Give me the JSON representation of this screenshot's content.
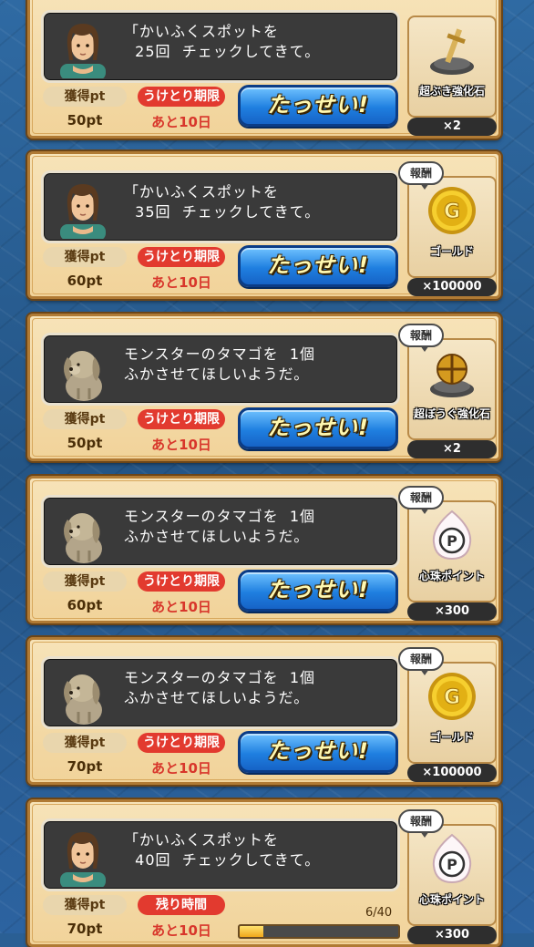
{
  "quests": [
    {
      "avatar": "woman-icon",
      "message_lines": [
        "「かいふくスポットを",
        "  25回  チェックしてきて。"
      ],
      "pt_label": "獲得pt",
      "pt_value": "50pt",
      "deadline_label": "うけとり期限",
      "remaining": "あと10日",
      "button_label": "たっせい!",
      "reward_label": "",
      "reward_icon": "sword-on-rock-icon",
      "reward_name": "超ぶき強化石",
      "reward_qty": "×2"
    },
    {
      "avatar": "woman-icon",
      "message_lines": [
        "「かいふくスポットを",
        "  35回  チェックしてきて。"
      ],
      "pt_label": "獲得pt",
      "pt_value": "60pt",
      "deadline_label": "うけとり期限",
      "remaining": "あと10日",
      "button_label": "たっせい!",
      "reward_label": "報酬",
      "reward_icon": "gold-coin-icon",
      "reward_name": "ゴールド",
      "reward_qty": "×100000"
    },
    {
      "avatar": "dog-icon",
      "message_lines": [
        "モンスターのタマゴを  1個",
        "ふかさせてほしいようだ。"
      ],
      "pt_label": "獲得pt",
      "pt_value": "50pt",
      "deadline_label": "うけとり期限",
      "remaining": "あと10日",
      "button_label": "たっせい!",
      "reward_label": "報酬",
      "reward_icon": "orb-on-rock-icon",
      "reward_name": "超ぼうぐ強化石",
      "reward_qty": "×2"
    },
    {
      "avatar": "dog-icon",
      "message_lines": [
        "モンスターのタマゴを  1個",
        "ふかさせてほしいようだ。"
      ],
      "pt_label": "獲得pt",
      "pt_value": "60pt",
      "deadline_label": "うけとり期限",
      "remaining": "あと10日",
      "button_label": "たっせい!",
      "reward_label": "報酬",
      "reward_icon": "heart-orb-point-icon",
      "reward_name": "心珠ポイント",
      "reward_qty": "×300"
    },
    {
      "avatar": "dog-icon",
      "message_lines": [
        "モンスターのタマゴを  1個",
        "ふかさせてほしいようだ。"
      ],
      "pt_label": "獲得pt",
      "pt_value": "70pt",
      "deadline_label": "うけとり期限",
      "remaining": "あと10日",
      "button_label": "たっせい!",
      "reward_label": "報酬",
      "reward_icon": "gold-coin-icon",
      "reward_name": "ゴールド",
      "reward_qty": "×100000"
    },
    {
      "avatar": "woman-icon",
      "message_lines": [
        "「かいふくスポットを",
        "  40回  チェックしてきて。"
      ],
      "pt_label": "獲得pt",
      "pt_value": "70pt",
      "deadline_label": "残り時間",
      "remaining": "あと10日",
      "progress_text": "6/40",
      "progress_fraction": 0.15,
      "reward_label": "報酬",
      "reward_icon": "heart-orb-point-icon",
      "reward_name": "心珠ポイント",
      "reward_qty": "×300"
    }
  ]
}
